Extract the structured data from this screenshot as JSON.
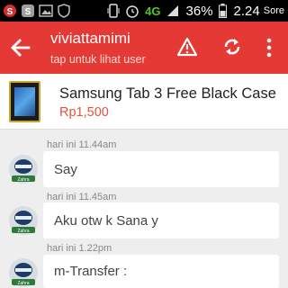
{
  "status_bar": {
    "left_icons": [
      "s-app-icon",
      "s-app-icon",
      "image-icon",
      "shield-icon"
    ],
    "network": "4G",
    "battery": "36%",
    "time": "2.24",
    "carrier": "Sore"
  },
  "app_bar": {
    "title": "viviattamimi",
    "subtitle": "tap untuk lihat user",
    "icons": [
      "back-arrow-icon",
      "warning-icon",
      "refresh-icon",
      "more-vert-icon"
    ]
  },
  "product": {
    "name": "Samsung Tab 3 Free Black Case",
    "price": "Rp1,500"
  },
  "messages": [
    {
      "time": "hari ini 11.44am",
      "text": "Say"
    },
    {
      "time": "hari ini 11.45am",
      "text": "Aku otw k Sana y"
    },
    {
      "time": "hari ini 1.22pm",
      "text": "m-Transfer :"
    }
  ],
  "colors": {
    "accent": "#e53935",
    "price": "#e5533c",
    "background": "#eeeeee"
  }
}
